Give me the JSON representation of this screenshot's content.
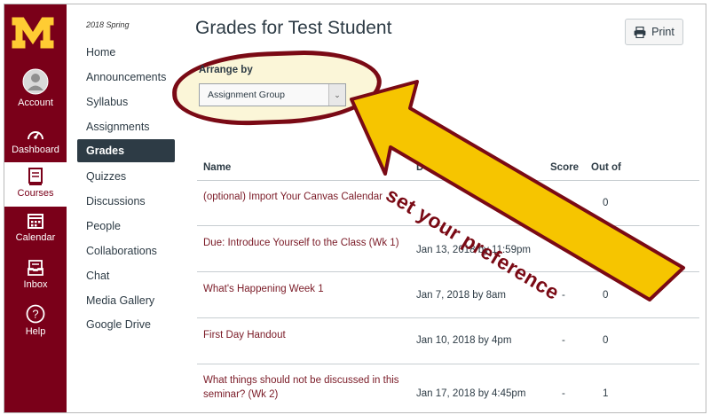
{
  "global_nav": {
    "items": [
      {
        "label": "Account",
        "icon": "account-avatar-icon"
      },
      {
        "label": "Dashboard",
        "icon": "dashboard-icon"
      },
      {
        "label": "Courses",
        "icon": "courses-icon"
      },
      {
        "label": "Calendar",
        "icon": "calendar-icon"
      },
      {
        "label": "Inbox",
        "icon": "inbox-icon"
      },
      {
        "label": "Help",
        "icon": "help-icon"
      }
    ],
    "active": "Courses"
  },
  "course_nav": {
    "term": "2018 Spring",
    "items": [
      "Home",
      "Announcements",
      "Syllabus",
      "Assignments",
      "Grades",
      "Quizzes",
      "Discussions",
      "People",
      "Collaborations",
      "Chat",
      "Media Gallery",
      "Google Drive"
    ],
    "active": "Grades"
  },
  "page": {
    "title": "Grades for Test Student",
    "print_label": "Print"
  },
  "arrange": {
    "label": "Arrange by",
    "selected": "Assignment Group"
  },
  "table": {
    "headers": {
      "name": "Name",
      "due": "D",
      "score": "Score",
      "out_of": "Out of"
    },
    "rows": [
      {
        "name": "(optional) Import Your Canvas Calendar",
        "due": "",
        "score": "",
        "out_of": "0"
      },
      {
        "name": "Due: Introduce Yourself to the Class (Wk 1)",
        "due": "Jan 13, 2018 by 11:59pm",
        "score": "-",
        "out_of": ""
      },
      {
        "name": "What's Happening Week 1",
        "due": "Jan 7, 2018 by 8am",
        "score": "-",
        "out_of": "0"
      },
      {
        "name": "First Day Handout",
        "due": "Jan 10, 2018 by 4pm",
        "score": "-",
        "out_of": "0"
      },
      {
        "name_line1": "What things should not be discussed in this",
        "name_line2": "seminar? (Wk 2)",
        "due": "Jan 17, 2018 by 4:45pm",
        "score": "-",
        "out_of": "1"
      }
    ]
  },
  "annotation": {
    "text": "set your preference",
    "colors": {
      "arrow_fill": "#f6c500",
      "arrow_stroke": "#7a0a15",
      "text": "#7a0a15"
    }
  },
  "colors": {
    "brand": "#7a0019",
    "logo_gold": "#ffcc33",
    "nav_active": "#2d3b45",
    "link": "#7a1a26"
  }
}
